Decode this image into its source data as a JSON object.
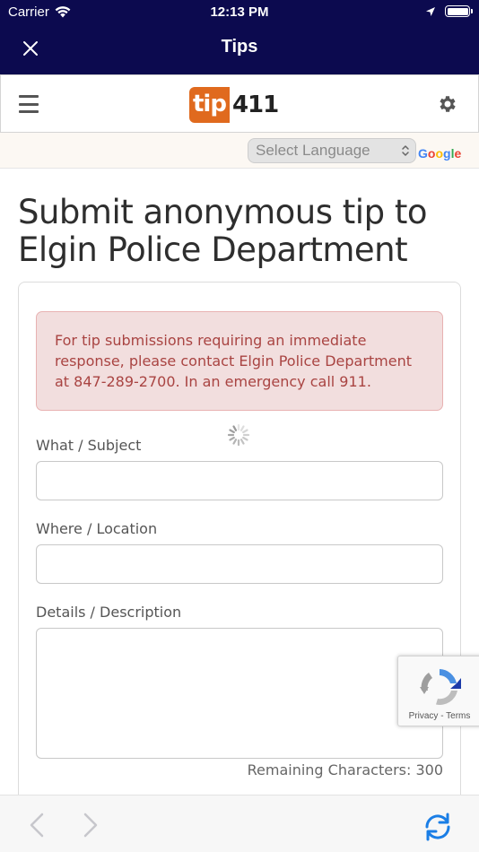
{
  "status_bar": {
    "carrier": "Carrier",
    "time": "12:13 PM"
  },
  "nav": {
    "title": "Tips"
  },
  "site": {
    "logo_tip": "tip",
    "logo_num": "411"
  },
  "language": {
    "select_label": "Select Language",
    "powered_by_letters": [
      "G",
      "o",
      "o",
      "g",
      "l",
      "e"
    ],
    "google_colors": [
      "#4285F4",
      "#EA4335",
      "#FBBC05",
      "#4285F4",
      "#34A853",
      "#EA4335"
    ]
  },
  "page": {
    "title": "Submit anonymous tip to Elgin Police Department"
  },
  "form": {
    "alert": "For tip submissions requiring an immediate response, please contact Elgin Police Department at 847-289-2700. In an emergency call 911.",
    "subject_label": "What / Subject",
    "subject_value": "",
    "location_label": "Where / Location",
    "location_value": "",
    "details_label": "Details / Description",
    "details_value": "",
    "remaining_chars": "Remaining Characters: 300"
  },
  "recaptcha": {
    "privacy": "Privacy",
    "separator": " - ",
    "terms": "Terms"
  },
  "colors": {
    "nav_bg": "#0c0a4f",
    "brand_orange": "#e06a1e",
    "alert_text": "#a94442",
    "alert_bg": "#f2dede",
    "ios_blue": "#1a7ee6"
  },
  "icons": {
    "close": "close-icon",
    "menu": "hamburger-menu-icon",
    "settings": "gear-icon",
    "back": "chevron-left-icon",
    "forward": "chevron-right-icon",
    "reload": "refresh-icon"
  }
}
